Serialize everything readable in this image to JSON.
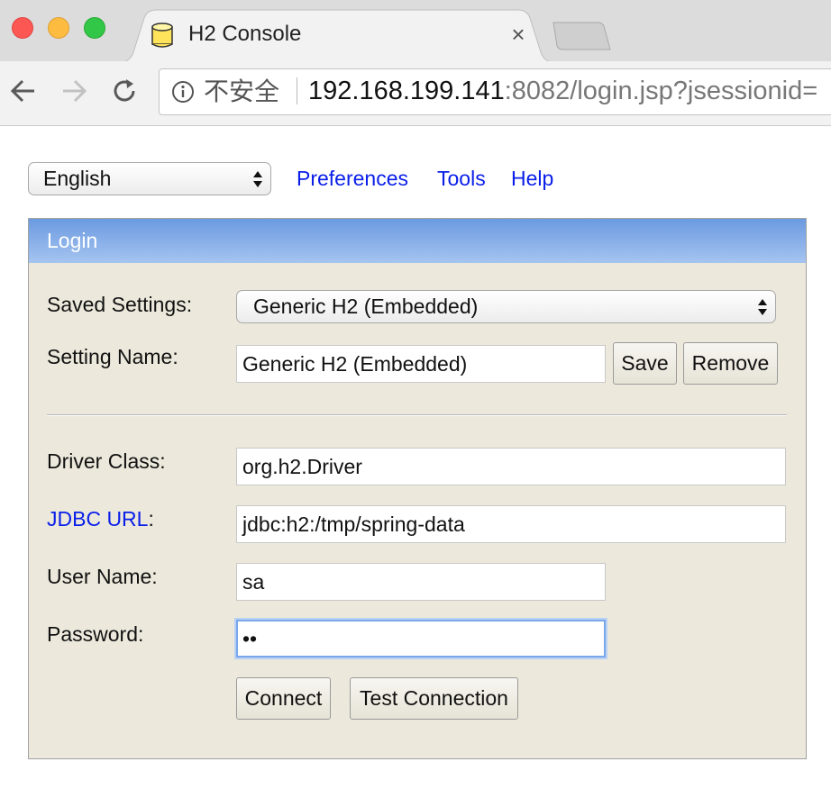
{
  "browser": {
    "tab_title": "H2 Console",
    "tab_close": "×",
    "security_label": "不安全",
    "url_host": "192.168.199.141",
    "url_rest": ":8082/login.jsp?jsessionid="
  },
  "topbar": {
    "language": "English",
    "links": [
      "Preferences",
      "Tools",
      "Help"
    ]
  },
  "login": {
    "header": "Login",
    "saved_settings_label": "Saved Settings:",
    "saved_settings_value": "Generic H2 (Embedded)",
    "setting_name_label": "Setting Name:",
    "setting_name_value": "Generic H2 (Embedded)",
    "save_button": "Save",
    "remove_button": "Remove",
    "driver_class_label": "Driver Class:",
    "driver_class_value": "org.h2.Driver",
    "jdbc_url_link": "JDBC URL",
    "jdbc_url_colon": ":",
    "jdbc_url_value": "jdbc:h2:/tmp/spring-data",
    "user_name_label": "User Name:",
    "user_name_value": "sa",
    "password_label": "Password:",
    "password_value": "••",
    "connect_button": "Connect",
    "test_connection_button": "Test Connection"
  },
  "colors": {
    "link": "#0a1ee8",
    "panel_bg": "#ece9dc",
    "header_top": "#6b9ae0",
    "header_bottom": "#a5c4f0",
    "focus_ring": "#7aa7ea"
  }
}
